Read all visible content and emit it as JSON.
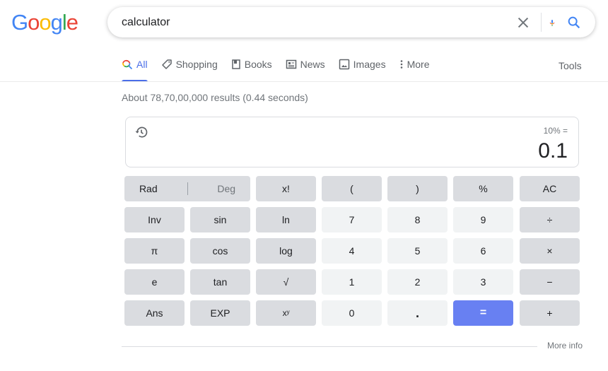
{
  "logo": {
    "letters": [
      {
        "char": "G",
        "color": "#4285f4"
      },
      {
        "char": "o",
        "color": "#ea4335"
      },
      {
        "char": "o",
        "color": "#fbbc05"
      },
      {
        "char": "g",
        "color": "#4285f4"
      },
      {
        "char": "l",
        "color": "#34a853"
      },
      {
        "char": "e",
        "color": "#ea4335"
      }
    ]
  },
  "search": {
    "value": "calculator",
    "icons": [
      "close-icon",
      "mic-icon",
      "search-icon"
    ]
  },
  "tabs": [
    {
      "label": "All",
      "icon": "search-icon",
      "active": true
    },
    {
      "label": "Shopping",
      "icon": "tag-icon",
      "active": false
    },
    {
      "label": "Books",
      "icon": "book-icon",
      "active": false
    },
    {
      "label": "News",
      "icon": "news-icon",
      "active": false
    },
    {
      "label": "Images",
      "icon": "image-icon",
      "active": false
    },
    {
      "label": "More",
      "icon": "more-vert-icon",
      "active": false
    }
  ],
  "tools_label": "Tools",
  "result_stats": "About 78,70,00,000 results (0.44 seconds)",
  "calculator": {
    "expression": "10% =",
    "result": "0.1",
    "rad_label": "Rad",
    "deg_label": "Deg",
    "keys": [
      [
        "x!",
        "(",
        ")",
        "%",
        "AC"
      ],
      [
        "Inv",
        "sin",
        "ln",
        "7",
        "8",
        "9",
        "÷"
      ],
      [
        "π",
        "cos",
        "log",
        "4",
        "5",
        "6",
        "×"
      ],
      [
        "e",
        "tan",
        "√",
        "1",
        "2",
        "3",
        "−"
      ],
      [
        "Ans",
        "EXP",
        "xʸ",
        "0",
        ".",
        "=",
        "+"
      ]
    ]
  },
  "more_info": "More info",
  "colors": {
    "accent": "#4b6ee8",
    "equals_key": "#6880f2",
    "func_key": "#dadce0",
    "num_key": "#f1f3f4"
  }
}
